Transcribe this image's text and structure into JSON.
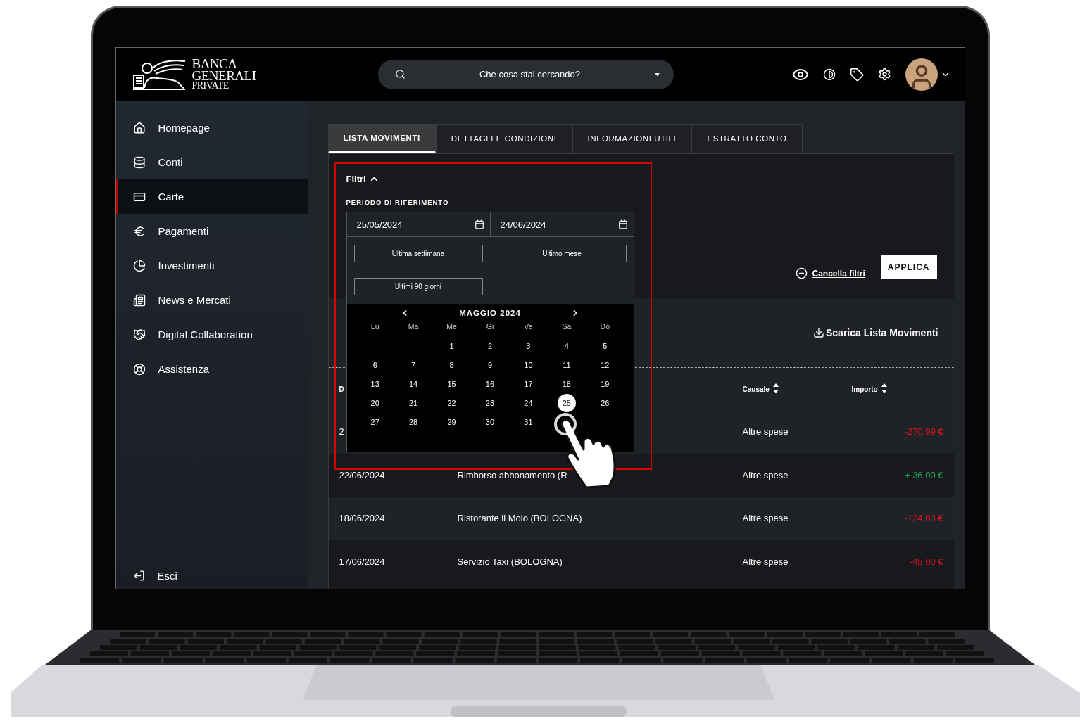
{
  "header": {
    "logo": {
      "line_1": "BANCA",
      "line_2": "GENERALI",
      "line_3": "PRIVATE"
    },
    "search": {
      "placeholder": "Che cosa stai cercando?"
    }
  },
  "sidebar": {
    "items": [
      {
        "label": "Homepage",
        "selected": false
      },
      {
        "label": "Conti",
        "selected": false
      },
      {
        "label": "Carte",
        "selected": true
      },
      {
        "label": "Pagamenti",
        "selected": false
      },
      {
        "label": "Investimenti",
        "selected": false
      },
      {
        "label": "News e Mercati",
        "selected": false
      },
      {
        "label": "Digital Collaboration",
        "selected": false
      },
      {
        "label": "Assistenza",
        "selected": false
      }
    ],
    "footer": {
      "label": "Esci"
    }
  },
  "tabs": [
    {
      "label": "LISTA MOVIMENTI",
      "selected": true
    },
    {
      "label": "DETTAGLI E CONDIZIONI",
      "selected": false
    },
    {
      "label": "INFORMAZIONI UTILI",
      "selected": false
    },
    {
      "label": "ESTRATTO CONTO",
      "selected": false
    }
  ],
  "filters": {
    "title": "Filtri",
    "expanded": true,
    "period_label": "PERIODO DI RIFERIMENTO",
    "date_from": "25/05/2024",
    "date_to": "24/06/2024",
    "presets": [
      "Ultima settimana",
      "Ultimo mese",
      "Ultimi 90 giorni"
    ],
    "calendar": {
      "month": "MAGGIO 2024",
      "weekdays": [
        "Lu",
        "Ma",
        "Me",
        "Gi",
        "Ve",
        "Sa",
        "Do"
      ],
      "weeks": [
        [
          {
            "kind": "blank"
          },
          {
            "kind": "blank"
          },
          {
            "kind": "day",
            "label": "1",
            "selected": false
          },
          {
            "kind": "day",
            "label": "2",
            "selected": false
          },
          {
            "kind": "day",
            "label": "3",
            "selected": false
          },
          {
            "kind": "day",
            "label": "4",
            "selected": false
          },
          {
            "kind": "day",
            "label": "5",
            "selected": false
          }
        ],
        [
          {
            "kind": "day",
            "label": "6",
            "selected": false
          },
          {
            "kind": "day",
            "label": "7",
            "selected": false
          },
          {
            "kind": "day",
            "label": "8",
            "selected": false
          },
          {
            "kind": "day",
            "label": "9",
            "selected": false
          },
          {
            "kind": "day",
            "label": "10",
            "selected": false
          },
          {
            "kind": "day",
            "label": "11",
            "selected": false
          },
          {
            "kind": "day",
            "label": "12",
            "selected": false
          }
        ],
        [
          {
            "kind": "day",
            "label": "13",
            "selected": false
          },
          {
            "kind": "day",
            "label": "14",
            "selected": false
          },
          {
            "kind": "day",
            "label": "15",
            "selected": false
          },
          {
            "kind": "day",
            "label": "16",
            "selected": false
          },
          {
            "kind": "day",
            "label": "17",
            "selected": false
          },
          {
            "kind": "day",
            "label": "18",
            "selected": false
          },
          {
            "kind": "day",
            "label": "19",
            "selected": false
          }
        ],
        [
          {
            "kind": "day",
            "label": "20",
            "selected": false
          },
          {
            "kind": "day",
            "label": "21",
            "selected": false
          },
          {
            "kind": "day",
            "label": "22",
            "selected": false
          },
          {
            "kind": "day",
            "label": "23",
            "selected": false
          },
          {
            "kind": "day",
            "label": "24",
            "selected": false
          },
          {
            "kind": "day",
            "label": "25",
            "selected": true
          },
          {
            "kind": "day",
            "label": "26",
            "selected": false
          }
        ],
        [
          {
            "kind": "day",
            "label": "27",
            "selected": false
          },
          {
            "kind": "day",
            "label": "28",
            "selected": false
          },
          {
            "kind": "day",
            "label": "29",
            "selected": false
          },
          {
            "kind": "day",
            "label": "30",
            "selected": false
          },
          {
            "kind": "day",
            "label": "31",
            "selected": false
          },
          {
            "kind": "blank"
          },
          {
            "kind": "blank"
          }
        ]
      ]
    },
    "clear": "Cancella filtri",
    "apply": "APPLICA"
  },
  "download": "Scarica Lista Movimenti",
  "table": {
    "columns": [
      {
        "label": "D",
        "sortable": false
      },
      {
        "label": "Causale",
        "sortable": true
      },
      {
        "label": "Importo",
        "sortable": true
      }
    ],
    "rows": [
      {
        "date": "2",
        "causale": "Altre spese",
        "amount": "-270,99 €",
        "kind": "debit"
      },
      {
        "date": "22/06/2024",
        "description": "Rimborso abbonamento (R",
        "causale": "Altre spese",
        "amount": "+ 36,00 €",
        "kind": "credit"
      },
      {
        "date": "18/06/2024",
        "description": "Ristorante il Molo (BOLOGNA)",
        "causale": "Altre spese",
        "amount": "-124,00 €",
        "kind": "debit"
      },
      {
        "date": "17/06/2024",
        "description": "Servizio Taxi (BOLOGNA)",
        "causale": "Altre spese",
        "amount": "-45,00 €",
        "kind": "debit"
      }
    ]
  }
}
